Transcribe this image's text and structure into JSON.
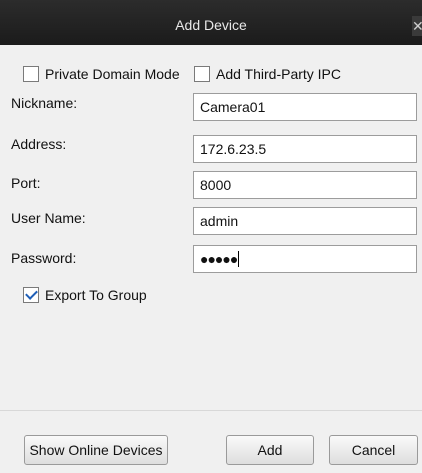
{
  "window": {
    "title": "Add Device",
    "close_glyph": "✕"
  },
  "options": {
    "private_domain_label": "Private Domain Mode",
    "private_domain_checked": false,
    "third_party_label": "Add Third-Party IPC",
    "third_party_checked": false
  },
  "fields": {
    "nickname_label": "Nickname:",
    "nickname_value": "Camera01",
    "address_label": "Address:",
    "address_value": "172.6.23.5",
    "port_label": "Port:",
    "port_value": "8000",
    "username_label": "User Name:",
    "username_value": "admin",
    "password_label": "Password:",
    "password_mask": "●●●●●"
  },
  "export": {
    "label": "Export To Group",
    "checked": true
  },
  "buttons": {
    "show_online": "Show Online Devices",
    "add": "Add",
    "cancel": "Cancel"
  }
}
